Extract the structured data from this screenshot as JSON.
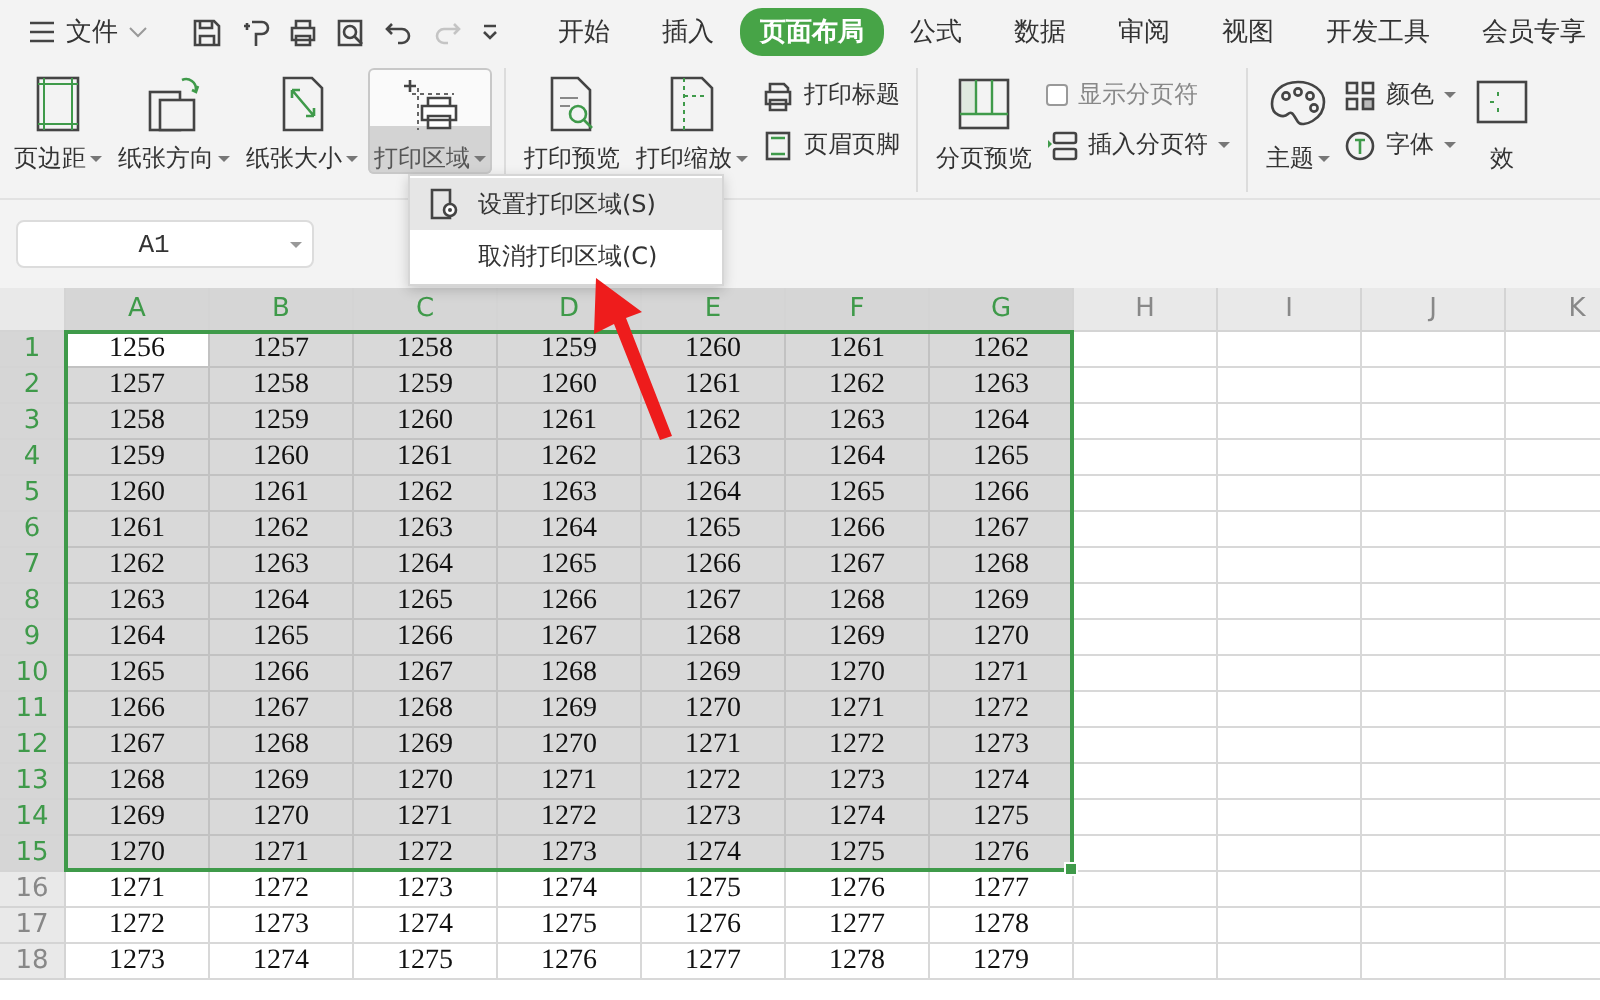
{
  "menu_button": {
    "label": "文件"
  },
  "tabs": [
    {
      "label": "开始",
      "selected": false
    },
    {
      "label": "插入",
      "selected": false
    },
    {
      "label": "页面布局",
      "selected": true
    },
    {
      "label": "公式",
      "selected": false
    },
    {
      "label": "数据",
      "selected": false
    },
    {
      "label": "审阅",
      "selected": false
    },
    {
      "label": "视图",
      "selected": false
    },
    {
      "label": "开发工具",
      "selected": false
    },
    {
      "label": "会员专享",
      "selected": false
    }
  ],
  "ribbon": {
    "groups": [
      {
        "items": [
          {
            "kind": "large",
            "label": "页边距",
            "dropdown": true,
            "pressed": false
          },
          {
            "kind": "large",
            "label": "纸张方向",
            "dropdown": true,
            "pressed": false
          },
          {
            "kind": "large",
            "label": "纸张大小",
            "dropdown": true,
            "pressed": false
          },
          {
            "kind": "large",
            "label": "打印区域",
            "dropdown": true,
            "pressed": true
          }
        ]
      },
      {
        "items": [
          {
            "kind": "large",
            "label": "打印预览",
            "dropdown": false,
            "pressed": false
          },
          {
            "kind": "large",
            "label": "打印缩放",
            "dropdown": true,
            "pressed": false
          },
          {
            "kind": "stack",
            "items": [
              {
                "kind": "small",
                "label": "打印标题",
                "dropdown": false
              },
              {
                "kind": "small",
                "label": "页眉页脚",
                "dropdown": false
              }
            ]
          }
        ]
      },
      {
        "items": [
          {
            "kind": "large",
            "label": "分页预览",
            "dropdown": false,
            "pressed": false
          },
          {
            "kind": "stack",
            "items": [
              {
                "kind": "checkbox",
                "label": "显示分页符",
                "checked": false
              },
              {
                "kind": "small",
                "label": "插入分页符",
                "dropdown": true
              }
            ]
          }
        ]
      },
      {
        "items": [
          {
            "kind": "large",
            "label": "主题",
            "dropdown": true,
            "pressed": false
          },
          {
            "kind": "stack",
            "items": [
              {
                "kind": "small",
                "label": "颜色",
                "dropdown": true
              },
              {
                "kind": "small",
                "label": "字体",
                "dropdown": true
              }
            ]
          },
          {
            "kind": "large",
            "label": "效",
            "dropdown": false,
            "pressed": false
          }
        ]
      }
    ]
  },
  "name_box": {
    "value": "A1"
  },
  "dropdown_menu": {
    "items": [
      {
        "label": "设置打印区域(S)",
        "selected": true
      },
      {
        "label": "取消打印区域(C)",
        "selected": false
      }
    ]
  },
  "sheet": {
    "columns": [
      {
        "label": "A",
        "selected": true
      },
      {
        "label": "B",
        "selected": true
      },
      {
        "label": "C",
        "selected": true
      },
      {
        "label": "D",
        "selected": true
      },
      {
        "label": "E",
        "selected": true
      },
      {
        "label": "F",
        "selected": true
      },
      {
        "label": "G",
        "selected": true
      },
      {
        "label": "H",
        "selected": false
      },
      {
        "label": "I",
        "selected": false
      },
      {
        "label": "J",
        "selected": false
      },
      {
        "label": "K",
        "selected": false
      }
    ],
    "rows": [
      {
        "label": "1",
        "selected": true,
        "cells": [
          "1256",
          "1257",
          "1258",
          "1259",
          "1260",
          "1261",
          "1262"
        ]
      },
      {
        "label": "2",
        "selected": true,
        "cells": [
          "1257",
          "1258",
          "1259",
          "1260",
          "1261",
          "1262",
          "1263"
        ]
      },
      {
        "label": "3",
        "selected": true,
        "cells": [
          "1258",
          "1259",
          "1260",
          "1261",
          "1262",
          "1263",
          "1264"
        ]
      },
      {
        "label": "4",
        "selected": true,
        "cells": [
          "1259",
          "1260",
          "1261",
          "1262",
          "1263",
          "1264",
          "1265"
        ]
      },
      {
        "label": "5",
        "selected": true,
        "cells": [
          "1260",
          "1261",
          "1262",
          "1263",
          "1264",
          "1265",
          "1266"
        ]
      },
      {
        "label": "6",
        "selected": true,
        "cells": [
          "1261",
          "1262",
          "1263",
          "1264",
          "1265",
          "1266",
          "1267"
        ]
      },
      {
        "label": "7",
        "selected": true,
        "cells": [
          "1262",
          "1263",
          "1264",
          "1265",
          "1266",
          "1267",
          "1268"
        ]
      },
      {
        "label": "8",
        "selected": true,
        "cells": [
          "1263",
          "1264",
          "1265",
          "1266",
          "1267",
          "1268",
          "1269"
        ]
      },
      {
        "label": "9",
        "selected": true,
        "cells": [
          "1264",
          "1265",
          "1266",
          "1267",
          "1268",
          "1269",
          "1270"
        ]
      },
      {
        "label": "10",
        "selected": true,
        "cells": [
          "1265",
          "1266",
          "1267",
          "1268",
          "1269",
          "1270",
          "1271"
        ]
      },
      {
        "label": "11",
        "selected": true,
        "cells": [
          "1266",
          "1267",
          "1268",
          "1269",
          "1270",
          "1271",
          "1272"
        ]
      },
      {
        "label": "12",
        "selected": true,
        "cells": [
          "1267",
          "1268",
          "1269",
          "1270",
          "1271",
          "1272",
          "1273"
        ]
      },
      {
        "label": "13",
        "selected": true,
        "cells": [
          "1268",
          "1269",
          "1270",
          "1271",
          "1272",
          "1273",
          "1274"
        ]
      },
      {
        "label": "14",
        "selected": true,
        "cells": [
          "1269",
          "1270",
          "1271",
          "1272",
          "1273",
          "1274",
          "1275"
        ]
      },
      {
        "label": "15",
        "selected": true,
        "cells": [
          "1270",
          "1271",
          "1272",
          "1273",
          "1274",
          "1275",
          "1276"
        ]
      },
      {
        "label": "16",
        "selected": false,
        "cells": [
          "1271",
          "1272",
          "1273",
          "1274",
          "1275",
          "1276",
          "1277"
        ]
      },
      {
        "label": "17",
        "selected": false,
        "cells": [
          "1272",
          "1273",
          "1274",
          "1275",
          "1276",
          "1277",
          "1278"
        ]
      },
      {
        "label": "18",
        "selected": false,
        "cells": [
          "1273",
          "1274",
          "1275",
          "1276",
          "1277",
          "1278",
          "1279"
        ]
      }
    ]
  }
}
